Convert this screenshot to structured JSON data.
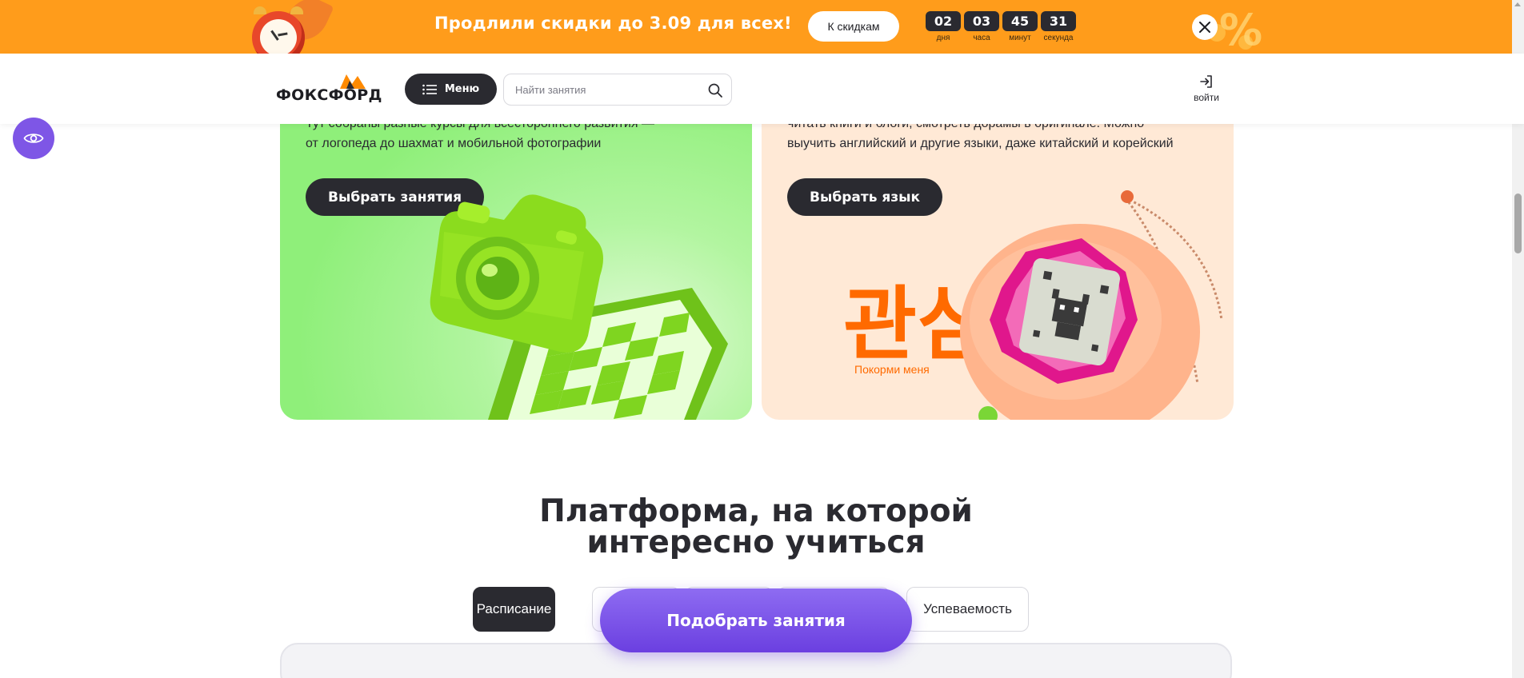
{
  "promo": {
    "title": "Продлили скидки до 3.09 для всех!",
    "button_label": "К скидкам",
    "timer": [
      {
        "value": "02",
        "unit": "дня"
      },
      {
        "value": "03",
        "unit": "часа"
      },
      {
        "value": "45",
        "unit": "минут"
      },
      {
        "value": "31",
        "unit": "секунда"
      }
    ],
    "deco_sign": "%",
    "accent_color": "#ff9c1b"
  },
  "header": {
    "logo_text": "ФОКСФОРД",
    "menu_label": "Меню",
    "search_placeholder": "Найти занятия",
    "login_label": "войти"
  },
  "cards": {
    "left": {
      "desc_line1": "Тут собраны разные курсы для всестороннего развития —",
      "desc_line2": "от логопеда до шахмат и мобильной фотографии",
      "button_label": "Выбрать занятия"
    },
    "right": {
      "desc_line1": "читать книги и блоги, смотреть дорамы в оригинале. Можно",
      "desc_line2": "выучить английский и другие языки, даже китайский и корейский",
      "button_label": "Выбрать язык",
      "art_korean_text": "관심",
      "art_caption": "Покорми меня"
    }
  },
  "platform": {
    "title_line1": "Платформа, на которой",
    "title_line2": "интересно учиться",
    "tabs": [
      {
        "label": "Расписание",
        "active": true
      },
      {
        "label": "",
        "active": false
      },
      {
        "label": "",
        "active": false
      },
      {
        "label": "",
        "active": false
      },
      {
        "label": "Успеваемость",
        "active": false
      }
    ],
    "cta_label": "Подобрать занятия"
  },
  "colors": {
    "dark": "#2a2a30",
    "purple": "#7e56e6",
    "green_card": "#8fef7a",
    "peach_card": "#ffe9d6",
    "orange_text": "#ff6a00"
  }
}
